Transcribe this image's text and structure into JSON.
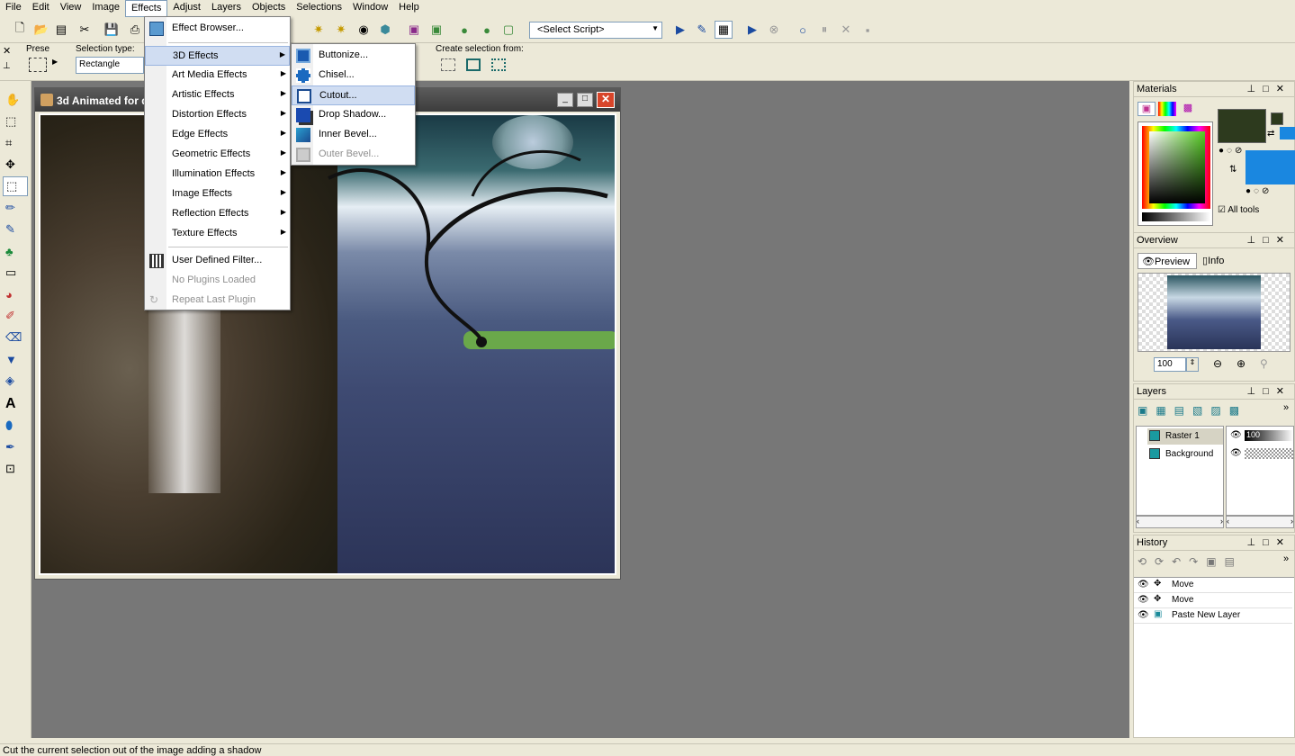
{
  "menu": [
    "File",
    "Edit",
    "View",
    "Image",
    "Effects",
    "Adjust",
    "Layers",
    "Objects",
    "Selections",
    "Window",
    "Help"
  ],
  "script_select": "<Select Script>",
  "options": {
    "preset_label": "Prese",
    "selection_type_label": "Selection type:",
    "selection_type_value": "Rectangle",
    "create_from_label": "Create selection from:"
  },
  "image_window": {
    "title": "3d Animated for d"
  },
  "effects_menu": {
    "items": [
      {
        "label": "Effect Browser...",
        "has_sub": false,
        "disabled": false
      },
      {
        "label": "3D Effects",
        "has_sub": true,
        "disabled": false
      },
      {
        "label": "Art Media Effects",
        "has_sub": true,
        "disabled": false
      },
      {
        "label": "Artistic Effects",
        "has_sub": true,
        "disabled": false
      },
      {
        "label": "Distortion Effects",
        "has_sub": true,
        "disabled": false
      },
      {
        "label": "Edge Effects",
        "has_sub": true,
        "disabled": false
      },
      {
        "label": "Geometric Effects",
        "has_sub": true,
        "disabled": false
      },
      {
        "label": "Illumination Effects",
        "has_sub": true,
        "disabled": false
      },
      {
        "label": "Image Effects",
        "has_sub": true,
        "disabled": false
      },
      {
        "label": "Reflection Effects",
        "has_sub": true,
        "disabled": false
      },
      {
        "label": "Texture Effects",
        "has_sub": true,
        "disabled": false
      },
      {
        "label": "User Defined Filter...",
        "has_sub": false,
        "disabled": false
      },
      {
        "label": "No Plugins Loaded",
        "has_sub": false,
        "disabled": true
      },
      {
        "label": "Repeat Last Plugin",
        "has_sub": false,
        "disabled": true
      }
    ]
  },
  "submenu_3d": {
    "items": [
      {
        "label": "Buttonize...",
        "disabled": false
      },
      {
        "label": "Chisel...",
        "disabled": false
      },
      {
        "label": "Cutout...",
        "disabled": false
      },
      {
        "label": "Drop Shadow...",
        "disabled": false
      },
      {
        "label": "Inner Bevel...",
        "disabled": false
      },
      {
        "label": "Outer Bevel...",
        "disabled": true
      }
    ]
  },
  "materials": {
    "title": "Materials",
    "all_tools_label": "All tools",
    "fg_color": "#2d3a1e",
    "bg_color": "#1a87e0"
  },
  "overview": {
    "title": "Overview",
    "tab_preview": "Preview",
    "tab_info": "Info",
    "zoom": "100"
  },
  "layers": {
    "title": "Layers",
    "items": [
      {
        "name": "Raster 1",
        "opacity": "100"
      },
      {
        "name": "Background",
        "opacity": ""
      }
    ]
  },
  "history": {
    "title": "History",
    "items": [
      "Move",
      "Move",
      "Paste New Layer"
    ]
  },
  "status": "Cut the current selection out of the image adding a shadow"
}
